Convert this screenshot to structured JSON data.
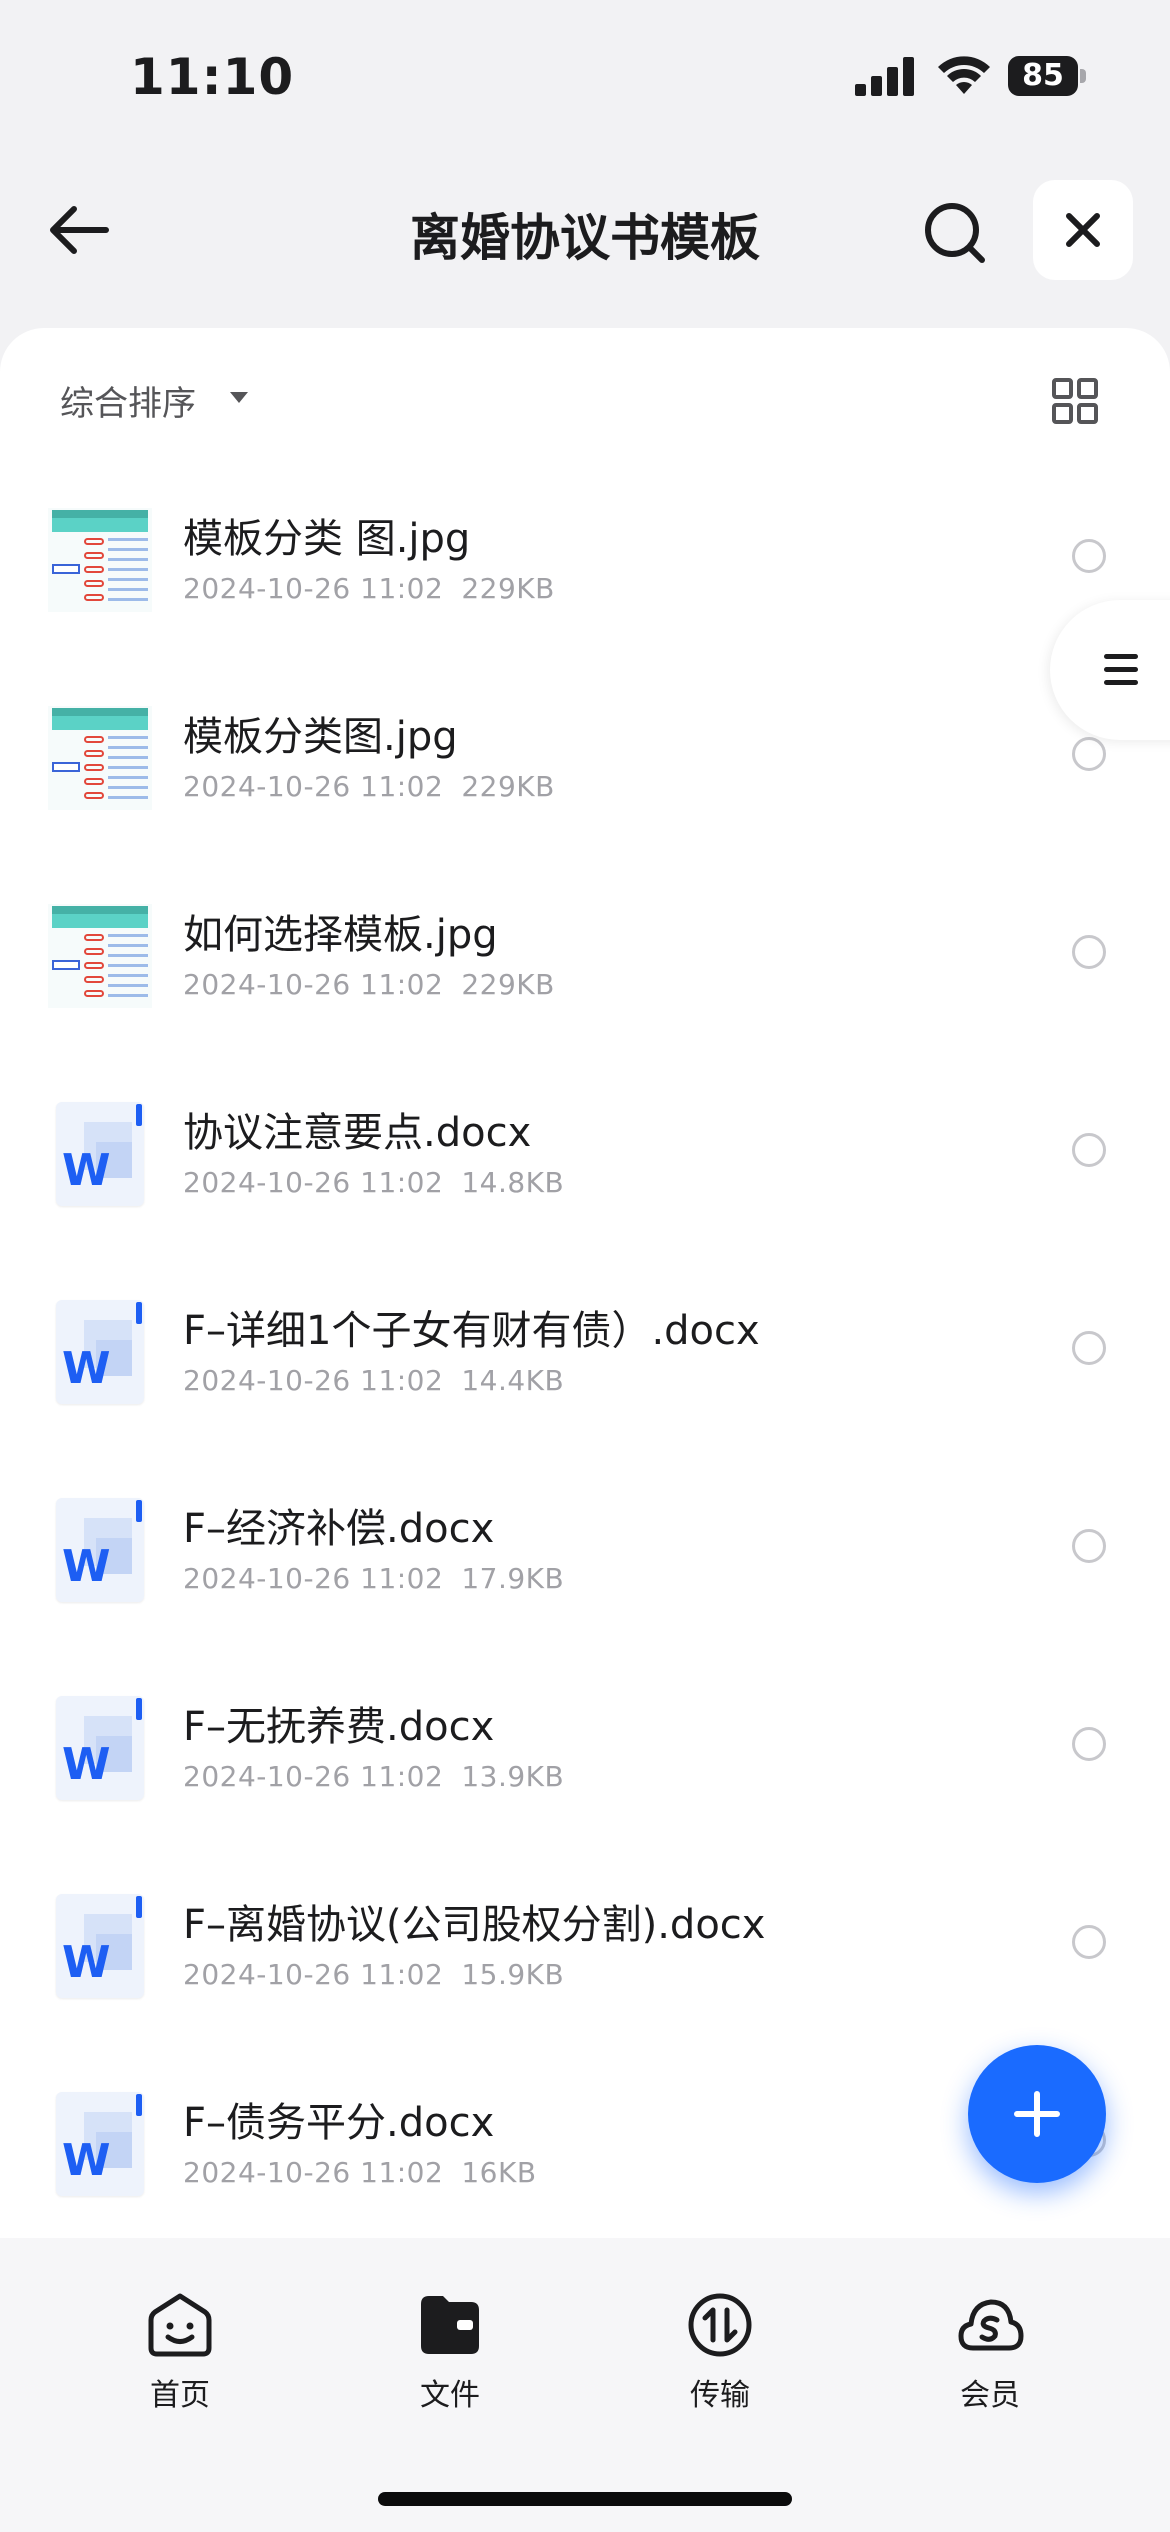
{
  "status_bar": {
    "time": "11:10",
    "battery": "85"
  },
  "nav": {
    "title": "离婚协议书模板",
    "back_icon": "arrow-left-icon",
    "search_icon": "search-icon",
    "close_icon": "close-icon"
  },
  "sort": {
    "label": "综合排序",
    "dropdown_icon": "triangle-down-icon",
    "view_icon": "grid-view-icon"
  },
  "files": [
    {
      "name": "模板分类 图.jpg",
      "date": "2024-10-26 11:02",
      "size": "229KB",
      "type": "image"
    },
    {
      "name": "模板分类图.jpg",
      "date": "2024-10-26 11:02",
      "size": "229KB",
      "type": "image"
    },
    {
      "name": "如何选择模板.jpg",
      "date": "2024-10-26 11:02",
      "size": "229KB",
      "type": "image"
    },
    {
      "name": "协议注意要点.docx",
      "date": "2024-10-26 11:02",
      "size": "14.8KB",
      "type": "word"
    },
    {
      "name": "F–详细1个子女有财有债）.docx",
      "date": "2024-10-26 11:02",
      "size": "14.4KB",
      "type": "word"
    },
    {
      "name": "F–经济补偿.docx",
      "date": "2024-10-26 11:02",
      "size": "17.9KB",
      "type": "word"
    },
    {
      "name": "F–无抚养费.docx",
      "date": "2024-10-26 11:02",
      "size": "13.9KB",
      "type": "word"
    },
    {
      "name": "F–离婚协议(公司股权分割).docx",
      "date": "2024-10-26 11:02",
      "size": "15.9KB",
      "type": "word"
    },
    {
      "name": "F–债务平分.docx",
      "date": "2024-10-26 11:02",
      "size": "16KB",
      "type": "word"
    }
  ],
  "word_icon_letter": "W",
  "fab": {
    "icon": "plus-icon"
  },
  "side_handle": {
    "icon": "menu-icon"
  },
  "tabs": [
    {
      "label": "首页",
      "icon": "home-smiley-icon"
    },
    {
      "label": "文件",
      "icon": "folder-icon"
    },
    {
      "label": "传输",
      "icon": "transfer-icon"
    },
    {
      "label": "会员",
      "icon": "cloud-vip-icon"
    }
  ],
  "colors": {
    "accent": "#1a6bff",
    "word_blue": "#1d5ef3",
    "meta_gray": "#a1a1a6",
    "background": "#f2f2f4"
  }
}
